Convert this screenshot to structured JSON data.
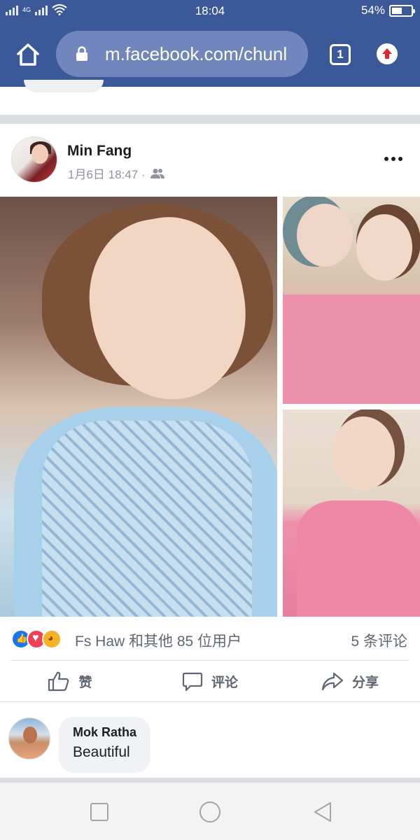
{
  "status_bar": {
    "network": "4G",
    "time": "18:04",
    "battery": "54%",
    "battery_level": 0.54
  },
  "browser": {
    "url": "m.facebook.com/chunl",
    "tab_count": "1"
  },
  "post": {
    "author": "Min Fang",
    "timestamp": "1月6日 18:47 ·",
    "audience_icon": "friends-icon",
    "reactions_summary": "Fs Haw 和其他 85 位用户",
    "comments_count": "5 条评论",
    "actions": [
      {
        "label": "赞",
        "icon": "thumbs-up-icon"
      },
      {
        "label": "评论",
        "icon": "comment-icon"
      },
      {
        "label": "分享",
        "icon": "share-icon"
      }
    ]
  },
  "comment": {
    "author": "Mok Ratha",
    "text": "Beautiful"
  },
  "colors": {
    "brand": "#3b5998",
    "url_pill": "#7286be",
    "like_blue": "#1877f2"
  }
}
